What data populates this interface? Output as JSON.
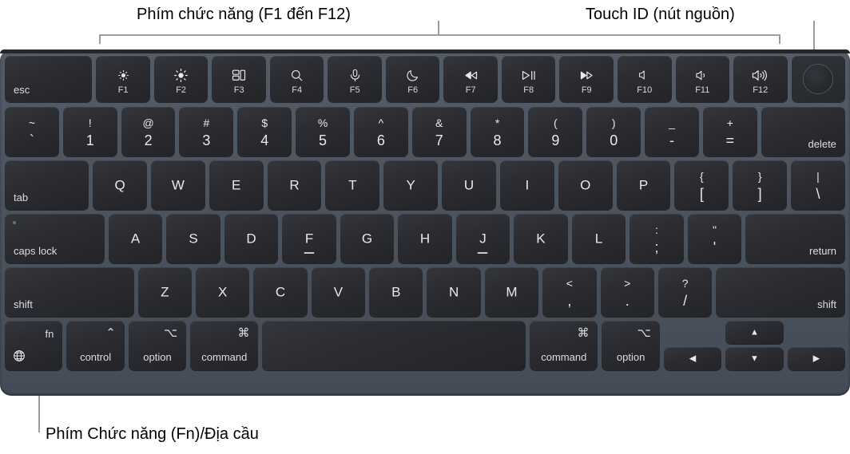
{
  "annotations": {
    "function_keys": "Phím chức năng (F1 đến F12)",
    "touch_id": "Touch ID (nút nguồn)",
    "fn_globe": "Phím Chức năng (Fn)/Địa cầu"
  },
  "colors": {
    "chassis": "#4c5460",
    "key": "#2b2d32",
    "legend": "#e8e9ea",
    "callout_line": "#9b9ea1",
    "label_text": "#000000"
  },
  "keyboard": {
    "function_row": [
      {
        "label": "esc",
        "icon": null,
        "fkey": null,
        "width": 1.62
      },
      {
        "label": null,
        "icon": "brightness-down-icon",
        "fkey": "F1",
        "width": 1
      },
      {
        "label": null,
        "icon": "brightness-up-icon",
        "fkey": "F2",
        "width": 1
      },
      {
        "label": null,
        "icon": "mission-control-icon",
        "fkey": "F3",
        "width": 1
      },
      {
        "label": null,
        "icon": "spotlight-search-icon",
        "fkey": "F4",
        "width": 1
      },
      {
        "label": null,
        "icon": "dictation-microphone-icon",
        "fkey": "F5",
        "width": 1
      },
      {
        "label": null,
        "icon": "do-not-disturb-moon-icon",
        "fkey": "F6",
        "width": 1
      },
      {
        "label": null,
        "icon": "rewind-icon",
        "fkey": "F7",
        "width": 1
      },
      {
        "label": null,
        "icon": "play-pause-icon",
        "fkey": "F8",
        "width": 1
      },
      {
        "label": null,
        "icon": "fast-forward-icon",
        "fkey": "F9",
        "width": 1
      },
      {
        "label": null,
        "icon": "mute-icon",
        "fkey": "F10",
        "width": 1
      },
      {
        "label": null,
        "icon": "volume-down-icon",
        "fkey": "F11",
        "width": 1
      },
      {
        "label": null,
        "icon": "volume-up-icon",
        "fkey": "F12",
        "width": 1
      },
      {
        "label": null,
        "icon": "touch-id-icon",
        "fkey": null,
        "width": 1
      }
    ],
    "number_row": [
      {
        "top": "~",
        "bottom": "`",
        "width": 1
      },
      {
        "top": "!",
        "bottom": "1",
        "width": 1
      },
      {
        "top": "@",
        "bottom": "2",
        "width": 1
      },
      {
        "top": "#",
        "bottom": "3",
        "width": 1
      },
      {
        "top": "$",
        "bottom": "4",
        "width": 1
      },
      {
        "top": "%",
        "bottom": "5",
        "width": 1
      },
      {
        "top": "^",
        "bottom": "6",
        "width": 1
      },
      {
        "top": "&",
        "bottom": "7",
        "width": 1
      },
      {
        "top": "*",
        "bottom": "8",
        "width": 1
      },
      {
        "top": "(",
        "bottom": "9",
        "width": 1
      },
      {
        "top": ")",
        "bottom": "0",
        "width": 1
      },
      {
        "top": "_",
        "bottom": "-",
        "width": 1
      },
      {
        "top": "+",
        "bottom": "=",
        "width": 1
      },
      {
        "label": "delete",
        "align": "bottom-right",
        "width": 1.55
      }
    ],
    "tab_row": [
      {
        "label": "tab",
        "align": "bottom-left",
        "width": 1.55
      },
      {
        "letter": "Q",
        "width": 1
      },
      {
        "letter": "W",
        "width": 1
      },
      {
        "letter": "E",
        "width": 1
      },
      {
        "letter": "R",
        "width": 1
      },
      {
        "letter": "T",
        "width": 1
      },
      {
        "letter": "Y",
        "width": 1
      },
      {
        "letter": "U",
        "width": 1
      },
      {
        "letter": "I",
        "width": 1
      },
      {
        "letter": "O",
        "width": 1
      },
      {
        "letter": "P",
        "width": 1
      },
      {
        "top": "{",
        "bottom": "[",
        "width": 1
      },
      {
        "top": "}",
        "bottom": "]",
        "width": 1
      },
      {
        "top": "|",
        "bottom": "\\",
        "width": 1
      }
    ],
    "home_row": [
      {
        "label": "caps lock",
        "align": "bottom-left",
        "led": true,
        "width": 1.85
      },
      {
        "letter": "A",
        "width": 1
      },
      {
        "letter": "S",
        "width": 1
      },
      {
        "letter": "D",
        "width": 1
      },
      {
        "letter": "F",
        "homing": true,
        "width": 1
      },
      {
        "letter": "G",
        "width": 1
      },
      {
        "letter": "H",
        "width": 1
      },
      {
        "letter": "J",
        "homing": true,
        "width": 1
      },
      {
        "letter": "K",
        "width": 1
      },
      {
        "letter": "L",
        "width": 1
      },
      {
        "top": ":",
        "bottom": ";",
        "width": 1
      },
      {
        "top": "\"",
        "bottom": "'",
        "width": 1
      },
      {
        "label": "return",
        "align": "bottom-right",
        "width": 1.85
      }
    ],
    "shift_row": [
      {
        "label": "shift",
        "align": "bottom-left",
        "width": 2.4
      },
      {
        "letter": "Z",
        "width": 1
      },
      {
        "letter": "X",
        "width": 1
      },
      {
        "letter": "C",
        "width": 1
      },
      {
        "letter": "V",
        "width": 1
      },
      {
        "letter": "B",
        "width": 1
      },
      {
        "letter": "N",
        "width": 1
      },
      {
        "letter": "M",
        "width": 1
      },
      {
        "top": "<",
        "bottom": ",",
        "width": 1
      },
      {
        "top": ">",
        "bottom": ".",
        "width": 1
      },
      {
        "top": "?",
        "bottom": "/",
        "width": 1
      },
      {
        "label": "shift",
        "align": "bottom-right",
        "width": 2.4
      }
    ],
    "bottom_row": {
      "fn_key": {
        "corner_label": "fn",
        "icon": "globe-icon"
      },
      "left_mods": [
        {
          "symbol": "⌃",
          "label": "control"
        },
        {
          "symbol": "⌥",
          "label": "option"
        },
        {
          "symbol": "⌘",
          "label": "command"
        }
      ],
      "space": {
        "label": ""
      },
      "right_mods": [
        {
          "symbol": "⌘",
          "label": "command"
        },
        {
          "symbol": "⌥",
          "label": "option"
        }
      ],
      "arrows": {
        "left": "◀",
        "up": "▲",
        "down": "▼",
        "right": "▶"
      }
    }
  }
}
